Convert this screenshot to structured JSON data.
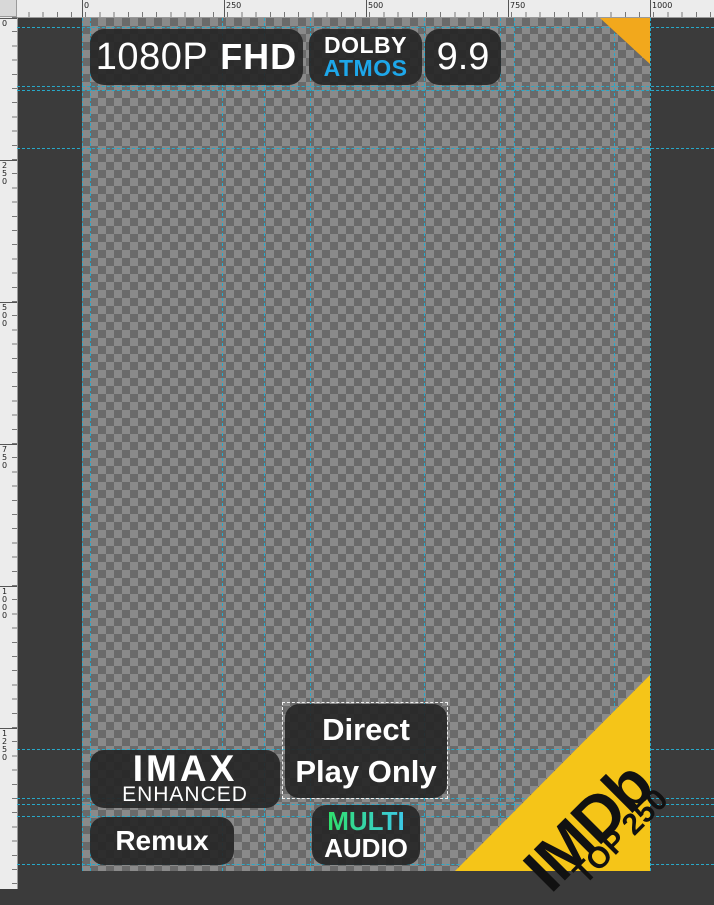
{
  "ruler": {
    "top_labels": [
      "0",
      "250",
      "500",
      "750",
      "1000"
    ],
    "left_labels": [
      "0",
      "250",
      "500",
      "750",
      "1000",
      "1250"
    ]
  },
  "badges": {
    "resolution": "1080P",
    "quality": "FHD",
    "audio_line1": "DOLBY",
    "audio_line2": "ATMOS",
    "rating": "9.9",
    "direct_line1": "Direct",
    "direct_line2": "Play Only",
    "imax_line1": "IMAX",
    "imax_line2": "ENHANCED",
    "remux": "Remux",
    "multi_line1": "MULTI",
    "multi_line2": "AUDIO",
    "imdb_main": "IMDb",
    "imdb_sub": "TOP 250"
  },
  "colors": {
    "canvas_bg": "#3b3b3b",
    "guide": "#29a9c9",
    "badge_bg": "#262626",
    "atmos_blue": "#1ea7ea",
    "imdb_yellow": "#f5c518",
    "corner_orange": "#f2a81c"
  }
}
